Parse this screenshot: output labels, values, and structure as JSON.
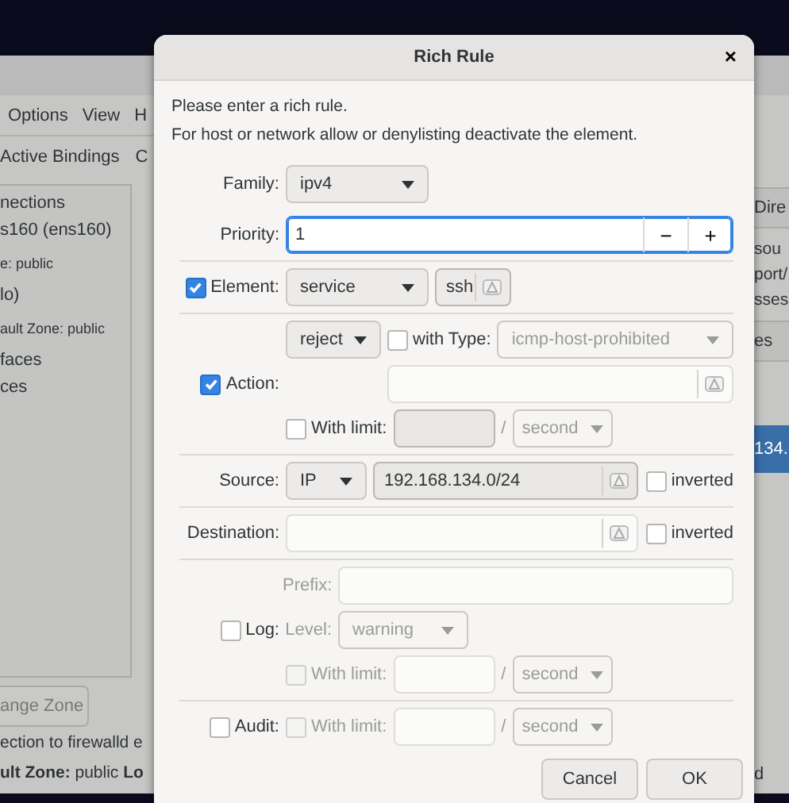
{
  "background_window": {
    "menu": [
      "Options",
      "View",
      "H"
    ],
    "panel_title": "Active Bindings",
    "cut_heading": "C",
    "bindings": [
      {
        "kind": "heading",
        "text": "nections"
      },
      {
        "kind": "item",
        "text": "s160 (ens160)"
      },
      {
        "kind": "sub",
        "text": "e: public"
      },
      {
        "kind": "item",
        "text": "lo)"
      },
      {
        "kind": "sub",
        "text": "ault Zone: public"
      },
      {
        "kind": "heading",
        "text": "faces"
      },
      {
        "kind": "heading",
        "text": "ces"
      }
    ],
    "change_zone_button": "ange Zone",
    "status_message": "ection to firewalld e",
    "status_zone": "**ult Zone:** public  **Lo**",
    "right_column": {
      "header": "Dire",
      "description": [
        "sou",
        "port/",
        "sses"
      ],
      "header_2": "es",
      "selected_row": "134.",
      "footer": "d"
    }
  },
  "dialog": {
    "title": "Rich Rule",
    "close": "×",
    "intro": [
      "Please enter a rich rule.",
      "For host or network allow or denylisting deactivate the element."
    ],
    "family": {
      "label": "Family:",
      "value": "ipv4"
    },
    "priority": {
      "label": "Priority:",
      "value": "1",
      "minus": "−",
      "plus": "+",
      "focused": true
    },
    "element": {
      "label": "Element:",
      "checked": true,
      "type": "service",
      "value": "ssh"
    },
    "action": {
      "label": "Action:",
      "checked": true,
      "value": "reject",
      "with_type": {
        "label": "with Type:",
        "checked": false,
        "value": "icmp-host-prohibited",
        "disabled": true
      },
      "text_disabled": true,
      "limit": {
        "label": "With limit:",
        "checked": false,
        "disabled": false,
        "separator": "/",
        "unit": "second"
      }
    },
    "source": {
      "label": "Source:",
      "type": "IP",
      "value": "192.168.134.0/24",
      "inverted": {
        "label": "inverted",
        "checked": false
      }
    },
    "destination": {
      "label": "Destination:",
      "disabled": true,
      "inverted": {
        "label": "inverted",
        "checked": false
      }
    },
    "log": {
      "label": "Log:",
      "checked": false,
      "disabled": true,
      "prefix_label": "Prefix:",
      "level_label": "Level:",
      "level": "warning",
      "limit": {
        "label": "With limit:",
        "checked": false,
        "disabled": true,
        "separator": "/",
        "unit": "second"
      }
    },
    "audit": {
      "label": "Audit:",
      "checked": false,
      "limit": {
        "label": "With limit:",
        "checked": false,
        "disabled": true,
        "separator": "/",
        "unit": "second"
      }
    },
    "buttons": [
      {
        "label": "Cancel"
      },
      {
        "label": "OK"
      }
    ]
  }
}
